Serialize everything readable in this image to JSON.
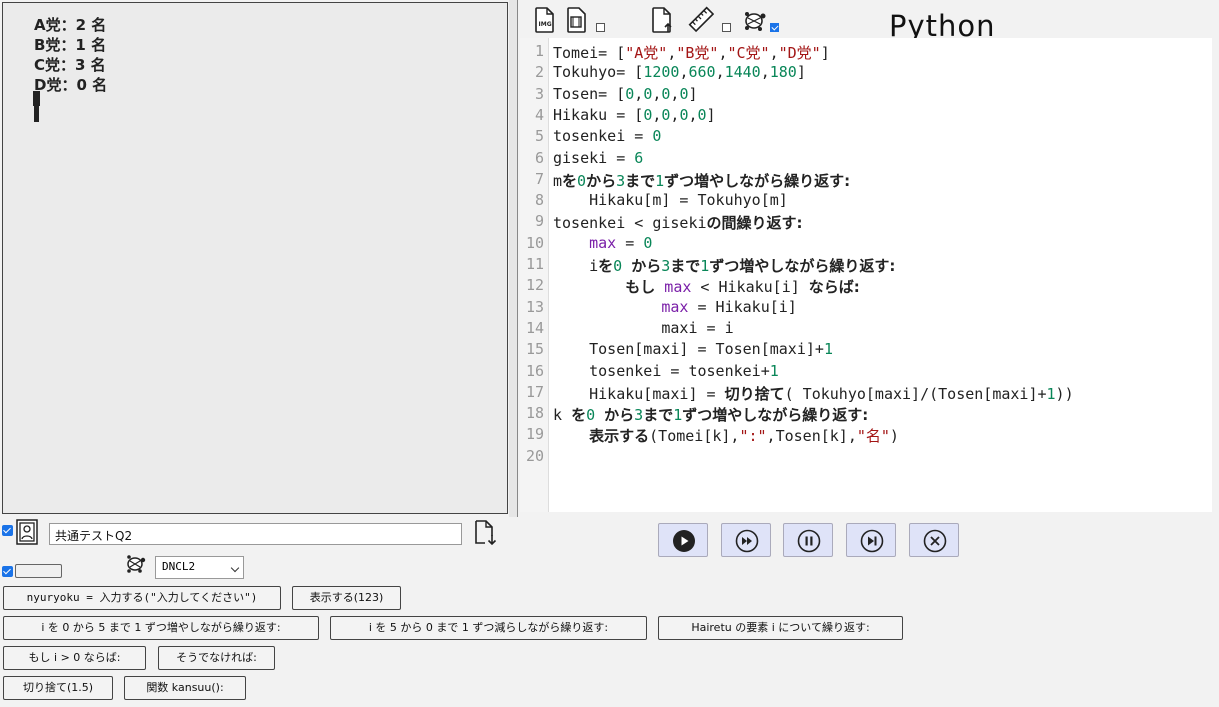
{
  "output": {
    "lines": [
      "A党：2 名",
      "B党：1 名",
      "C党：3 名",
      "D党：0 名"
    ]
  },
  "toolbar": {
    "icons": [
      "img-icon",
      "film-icon",
      "upload-file-icon",
      "ruler-icon",
      "turtle-icon"
    ],
    "language_logo": "Python"
  },
  "editor": {
    "line_numbers": [
      "1",
      "2",
      "3",
      "4",
      "5",
      "6",
      "7",
      "8",
      "9",
      "10",
      "11",
      "12",
      "13",
      "14",
      "15",
      "16",
      "17",
      "18",
      "19",
      "20"
    ],
    "lines": [
      [
        {
          "t": "Tomei= ["
        },
        {
          "t": "\"A党\"",
          "c": "str"
        },
        {
          "t": ","
        },
        {
          "t": "\"B党\"",
          "c": "str"
        },
        {
          "t": ","
        },
        {
          "t": "\"C党\"",
          "c": "str"
        },
        {
          "t": ","
        },
        {
          "t": "\"D党\"",
          "c": "str"
        },
        {
          "t": "]"
        }
      ],
      [
        {
          "t": "Tokuhyo= ["
        },
        {
          "t": "1200",
          "c": "num"
        },
        {
          "t": ","
        },
        {
          "t": "660",
          "c": "num"
        },
        {
          "t": ","
        },
        {
          "t": "1440",
          "c": "num"
        },
        {
          "t": ","
        },
        {
          "t": "180",
          "c": "num"
        },
        {
          "t": "]"
        }
      ],
      [
        {
          "t": "Tosen= ["
        },
        {
          "t": "0",
          "c": "num"
        },
        {
          "t": ","
        },
        {
          "t": "0",
          "c": "num"
        },
        {
          "t": ","
        },
        {
          "t": "0",
          "c": "num"
        },
        {
          "t": ","
        },
        {
          "t": "0",
          "c": "num"
        },
        {
          "t": "]"
        }
      ],
      [
        {
          "t": "Hikaku = ["
        },
        {
          "t": "0",
          "c": "num"
        },
        {
          "t": ","
        },
        {
          "t": "0",
          "c": "num"
        },
        {
          "t": ","
        },
        {
          "t": "0",
          "c": "num"
        },
        {
          "t": ","
        },
        {
          "t": "0",
          "c": "num"
        },
        {
          "t": "]"
        }
      ],
      [
        {
          "t": "tosenkei = "
        },
        {
          "t": "0",
          "c": "num"
        }
      ],
      [
        {
          "t": "giseki = "
        },
        {
          "t": "6",
          "c": "num"
        }
      ],
      [
        {
          "t": "m"
        },
        {
          "t": "を",
          "c": "b"
        },
        {
          "t": "0",
          "c": "num"
        },
        {
          "t": "から",
          "c": "b"
        },
        {
          "t": "3",
          "c": "num"
        },
        {
          "t": "まで",
          "c": "b"
        },
        {
          "t": "1",
          "c": "num"
        },
        {
          "t": "ずつ増やしながら繰り返す:",
          "c": "b"
        }
      ],
      [
        {
          "t": "    Hikaku[m] = Tokuhyo[m]"
        }
      ],
      [
        {
          "t": "tosenkei < giseki"
        },
        {
          "t": "の間繰り返す:",
          "c": "b"
        }
      ],
      [
        {
          "t": "    "
        },
        {
          "t": "max",
          "c": "kw"
        },
        {
          "t": " = "
        },
        {
          "t": "0",
          "c": "num"
        }
      ],
      [
        {
          "t": "    i"
        },
        {
          "t": "を",
          "c": "b"
        },
        {
          "t": "0",
          "c": "num"
        },
        {
          "t": " "
        },
        {
          "t": "から",
          "c": "b"
        },
        {
          "t": "3",
          "c": "num"
        },
        {
          "t": "まで",
          "c": "b"
        },
        {
          "t": "1",
          "c": "num"
        },
        {
          "t": "ずつ増やしながら繰り返す:",
          "c": "b"
        }
      ],
      [
        {
          "t": "        "
        },
        {
          "t": "もし",
          "c": "b"
        },
        {
          "t": " "
        },
        {
          "t": "max",
          "c": "kw"
        },
        {
          "t": " < Hikaku[i] "
        },
        {
          "t": "ならば:",
          "c": "b"
        }
      ],
      [
        {
          "t": "            "
        },
        {
          "t": "max",
          "c": "kw"
        },
        {
          "t": " = Hikaku[i]"
        }
      ],
      [
        {
          "t": "            maxi = i"
        }
      ],
      [
        {
          "t": "    Tosen[maxi] = Tosen[maxi]+"
        },
        {
          "t": "1",
          "c": "num"
        }
      ],
      [
        {
          "t": "    tosenkei = tosenkei+"
        },
        {
          "t": "1",
          "c": "num"
        }
      ],
      [
        {
          "t": "    Hikaku[maxi] = "
        },
        {
          "t": "切り捨て",
          "c": "b"
        },
        {
          "t": "( Tokuhyo[maxi]/(Tosen[maxi]+"
        },
        {
          "t": "1",
          "c": "num"
        },
        {
          "t": "))"
        }
      ],
      [
        {
          "t": "k "
        },
        {
          "t": "を",
          "c": "b"
        },
        {
          "t": "0",
          "c": "num"
        },
        {
          "t": " "
        },
        {
          "t": "から",
          "c": "b"
        },
        {
          "t": "3",
          "c": "num"
        },
        {
          "t": "まで",
          "c": "b"
        },
        {
          "t": "1",
          "c": "num"
        },
        {
          "t": "ずつ増やしながら繰り返す:",
          "c": "b"
        }
      ],
      [
        {
          "t": "    "
        },
        {
          "t": "表示する",
          "c": "b"
        },
        {
          "t": "(Tomei[k],"
        },
        {
          "t": "\":\"",
          "c": "str"
        },
        {
          "t": ",Tosen[k],"
        },
        {
          "t": "\"名\"",
          "c": "str"
        },
        {
          "t": ")"
        }
      ],
      []
    ]
  },
  "controls": [
    "play-button",
    "fast-forward-button",
    "pause-button",
    "step-button",
    "stop-button"
  ],
  "file": {
    "name": "共通テストQ2"
  },
  "language_select": {
    "selected": "DNCL2"
  },
  "snippets": {
    "nyuryoku": "nyuryoku = 入力する(\"入力してください\")",
    "hyoji": "表示する(123)",
    "for_up": "i を 0 から 5 まで 1 ずつ増やしながら繰り返す:",
    "for_down": "i を 5 から 0 まで 1 ずつ減らしながら繰り返す:",
    "for_each": "Hairetu の要素 i について繰り返す:",
    "if": "もし i > 0 ならば:",
    "else": "そうでなければ:",
    "floor": "切り捨て(1.5)",
    "func": "関数 kansuu():"
  },
  "colors": {
    "string": "#a31515",
    "number": "#098658",
    "keyword": "#7a1fa8",
    "control_bg": "#dfe3f8",
    "checkbox": "#1a73e8"
  }
}
